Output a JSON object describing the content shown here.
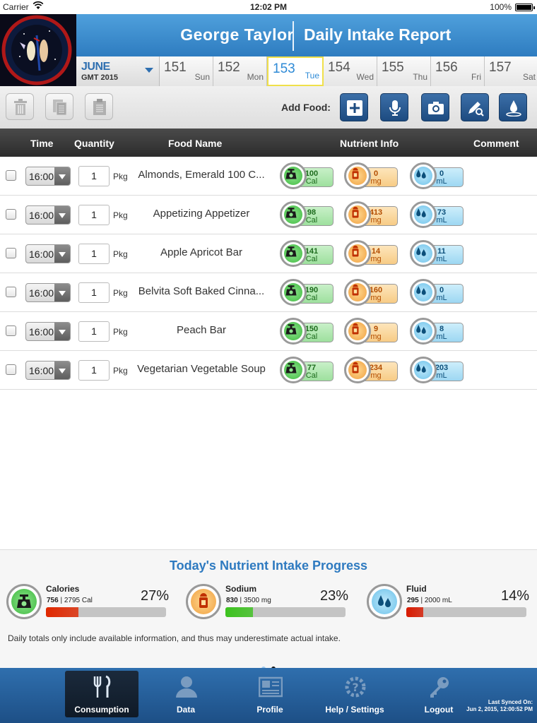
{
  "status_bar": {
    "carrier": "Carrier",
    "time": "12:02 PM",
    "battery": "100%"
  },
  "header": {
    "name": "George  Taylor",
    "title": "Daily Intake Report"
  },
  "calendar": {
    "month": "JUNE",
    "gmt": "GMT 2015",
    "days": [
      {
        "num": "151",
        "dow": "Sun"
      },
      {
        "num": "152",
        "dow": "Mon"
      },
      {
        "num": "153",
        "dow": "Tue",
        "selected": true
      },
      {
        "num": "154",
        "dow": "Wed"
      },
      {
        "num": "155",
        "dow": "Thu"
      },
      {
        "num": "156",
        "dow": "Fri"
      },
      {
        "num": "157",
        "dow": "Sat"
      }
    ]
  },
  "toolbar": {
    "add_food_label": "Add Food:"
  },
  "table": {
    "columns": {
      "time": "Time",
      "quantity": "Quantity",
      "food_name": "Food Name",
      "nutrient_info": "Nutrient Info",
      "comment": "Comment"
    },
    "rows": [
      {
        "time": "16:00",
        "qty": "1",
        "unit": "Pkg",
        "food": "Almonds, Emerald 100 C...",
        "cal": "100",
        "cal_unit": "Cal",
        "sodium": "0",
        "sodium_unit": "mg",
        "fluid": "0",
        "fluid_unit": "mL"
      },
      {
        "time": "16:00",
        "qty": "1",
        "unit": "Pkg",
        "food": "Appetizing Appetizer",
        "cal": "98",
        "cal_unit": "Cal",
        "sodium": "413",
        "sodium_unit": "mg",
        "fluid": "73",
        "fluid_unit": "mL"
      },
      {
        "time": "16:00",
        "qty": "1",
        "unit": "Pkg",
        "food": "Apple Apricot Bar",
        "cal": "141",
        "cal_unit": "Cal",
        "sodium": "14",
        "sodium_unit": "mg",
        "fluid": "11",
        "fluid_unit": "mL"
      },
      {
        "time": "16:00",
        "qty": "1",
        "unit": "Pkg",
        "food": "Belvita Soft Baked Cinna...",
        "cal": "190",
        "cal_unit": "Cal",
        "sodium": "160",
        "sodium_unit": "mg",
        "fluid": "0",
        "fluid_unit": "mL"
      },
      {
        "time": "16:00",
        "qty": "1",
        "unit": "Pkg",
        "food": "Peach Bar",
        "cal": "150",
        "cal_unit": "Cal",
        "sodium": "9",
        "sodium_unit": "mg",
        "fluid": "8",
        "fluid_unit": "mL"
      },
      {
        "time": "16:00",
        "qty": "1",
        "unit": "Pkg",
        "food": "Vegetarian Vegetable Soup",
        "cal": "77",
        "cal_unit": "Cal",
        "sodium": "234",
        "sodium_unit": "mg",
        "fluid": "203",
        "fluid_unit": "mL"
      }
    ]
  },
  "progress": {
    "title": "Today's Nutrient Intake Progress",
    "items": [
      {
        "label": "Calories",
        "current": "756",
        "target": "| 2795 Cal",
        "percent": "27%",
        "fraction": 0.27,
        "color": "#e02800"
      },
      {
        "label": "Sodium",
        "current": "830",
        "target": "| 3500 mg",
        "percent": "23%",
        "fraction": 0.23,
        "color": "#3cc21e"
      },
      {
        "label": "Fluid",
        "current": "295",
        "target": "| 2000 mL",
        "percent": "14%",
        "fraction": 0.14,
        "color": "#d81a00"
      }
    ],
    "note": "Daily totals only include available information, and thus may underestimate actual intake."
  },
  "tabs": [
    {
      "label": "Consumption",
      "active": true
    },
    {
      "label": "Data"
    },
    {
      "label": "Profile"
    },
    {
      "label": "Help / Settings"
    },
    {
      "label": "Logout"
    }
  ],
  "sync": {
    "line1": "Last Synced On:",
    "line2": "Jun 2, 2015, 12:00:52 PM"
  },
  "colors": {
    "header_blue": "#3a8ad0",
    "accent_blue": "#2e7ac0",
    "tabbar_blue": "#2563a0"
  }
}
